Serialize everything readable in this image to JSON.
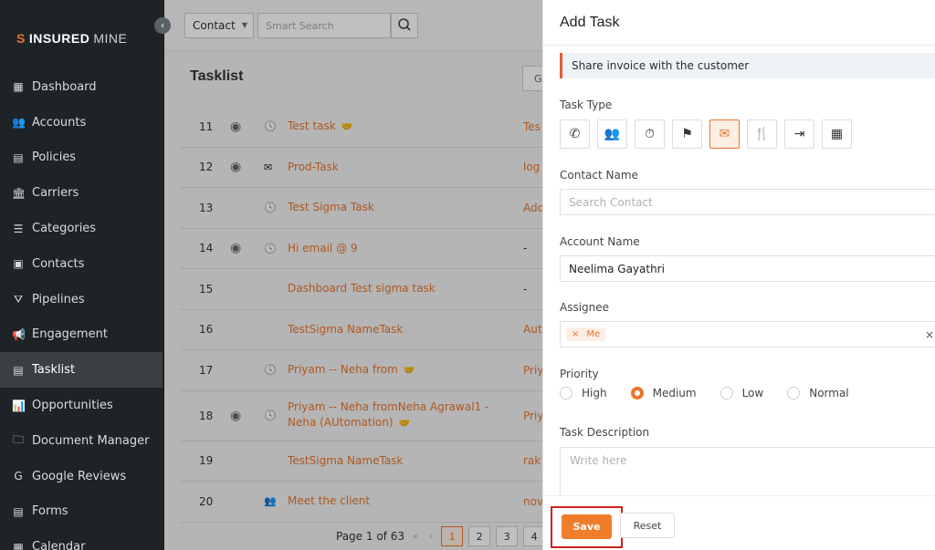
{
  "brand": {
    "name_bold": "INSURED",
    "name_light": "MINE"
  },
  "sidebar": {
    "items": [
      {
        "label": "Dashboard",
        "icon": "dashboard-icon"
      },
      {
        "label": "Accounts",
        "icon": "accounts-icon"
      },
      {
        "label": "Policies",
        "icon": "policies-icon"
      },
      {
        "label": "Carriers",
        "icon": "carriers-icon"
      },
      {
        "label": "Categories",
        "icon": "categories-icon"
      },
      {
        "label": "Contacts",
        "icon": "contacts-icon"
      },
      {
        "label": "Pipelines",
        "icon": "pipelines-icon"
      },
      {
        "label": "Engagement",
        "icon": "megaphone-icon"
      },
      {
        "label": "Tasklist",
        "icon": "tasklist-icon",
        "active": true
      },
      {
        "label": "Opportunities",
        "icon": "chart-icon"
      },
      {
        "label": "Document Manager",
        "icon": "folder-icon"
      },
      {
        "label": "Google Reviews",
        "icon": "google-icon"
      },
      {
        "label": "Forms",
        "icon": "forms-icon"
      },
      {
        "label": "Calendar",
        "icon": "calendar-icon"
      }
    ]
  },
  "topbar": {
    "contact_select": "Contact",
    "search_placeholder": "Smart Search"
  },
  "tasklist": {
    "title": "Tasklist",
    "rows": [
      {
        "num": "11",
        "eye": true,
        "type": "clock",
        "name": "Test task",
        "handshake": true,
        "account": "Tes"
      },
      {
        "num": "12",
        "eye": true,
        "type": "mail",
        "name": "Prod-Task",
        "handshake": false,
        "account": "log"
      },
      {
        "num": "13",
        "eye": false,
        "type": "clock",
        "name": "Test Sigma Task",
        "handshake": false,
        "account": "Add"
      },
      {
        "num": "14",
        "eye": true,
        "type": "clock",
        "name": "Hi email @ 9",
        "handshake": false,
        "account": "-"
      },
      {
        "num": "15",
        "eye": false,
        "type": "",
        "name": "Dashboard Test sigma task",
        "handshake": false,
        "account": "-"
      },
      {
        "num": "16",
        "eye": false,
        "type": "",
        "name": "TestSigma NameTask",
        "handshake": false,
        "account": "Aut"
      },
      {
        "num": "17",
        "eye": false,
        "type": "clock",
        "name": "Priyam -- Neha from",
        "handshake": true,
        "account": "Priy"
      },
      {
        "num": "18",
        "eye": true,
        "type": "clock",
        "name": "Priyam -- Neha fromNeha Agrawal1 - Neha (AUtomation)",
        "handshake": true,
        "account": "Priy"
      },
      {
        "num": "19",
        "eye": false,
        "type": "",
        "name": "TestSigma NameTask",
        "handshake": false,
        "account": "rak"
      },
      {
        "num": "20",
        "eye": false,
        "type": "user",
        "name": "Meet the client",
        "handshake": false,
        "account": "nov"
      }
    ]
  },
  "pager": {
    "text": "Page 1 of 63",
    "pages": [
      "1",
      "2",
      "3",
      "4"
    ],
    "current": "1"
  },
  "drawer": {
    "title": "Add Task",
    "subject": "Share invoice with the customer",
    "task_type_label": "Task Type",
    "task_types": [
      {
        "name": "phone-icon",
        "glyph": "✆",
        "selected": false
      },
      {
        "name": "meeting-icon",
        "glyph": "👥",
        "selected": false
      },
      {
        "name": "clock-icon",
        "glyph": "⏱",
        "selected": false
      },
      {
        "name": "flag-icon",
        "glyph": "⚑",
        "selected": false
      },
      {
        "name": "email-icon",
        "glyph": "✉",
        "selected": true
      },
      {
        "name": "lunch-icon",
        "glyph": "🍴",
        "selected": false
      },
      {
        "name": "exit-icon",
        "glyph": "⇥",
        "selected": false
      },
      {
        "name": "grid-icon",
        "glyph": "▦",
        "selected": false
      }
    ],
    "contact_label": "Contact Name",
    "contact_placeholder": "Search Contact",
    "account_label": "Account Name",
    "account_value": "Neelima Gayathri",
    "assignee_label": "Assignee",
    "assignee_chip": "Me",
    "priority_label": "Priority",
    "priorities": [
      {
        "label": "High",
        "selected": false
      },
      {
        "label": "Medium",
        "selected": true
      },
      {
        "label": "Low",
        "selected": false
      },
      {
        "label": "Normal",
        "selected": false
      }
    ],
    "description_label": "Task Description",
    "description_placeholder": "Write here",
    "save_label": "Save",
    "reset_label": "Reset"
  },
  "colors": {
    "accent": "#e8762e",
    "sidebar_bg": "#1d2326",
    "highlight": "#d0201c"
  }
}
